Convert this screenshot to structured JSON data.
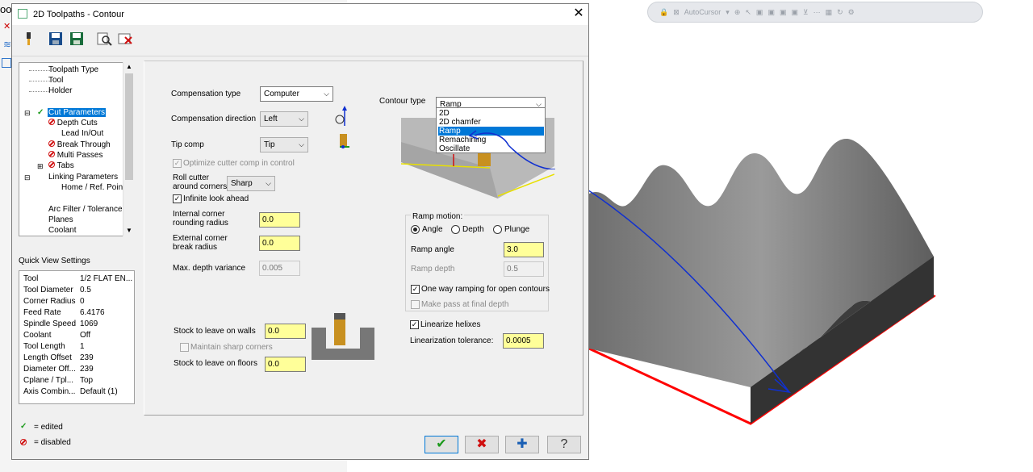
{
  "bg_app": {
    "partial_text": "ool",
    "float_toolbar": {
      "autocursor_label": "AutoCursor"
    }
  },
  "dialog": {
    "title": "2D Toolpaths - Contour",
    "close_glyph": "✕"
  },
  "tree": {
    "items": [
      {
        "label": "Toolpath Type"
      },
      {
        "label": "Tool"
      },
      {
        "label": "Holder"
      },
      {
        "label": "Cut Parameters"
      },
      {
        "label": "Depth Cuts"
      },
      {
        "label": "Lead In/Out"
      },
      {
        "label": "Break Through"
      },
      {
        "label": "Multi Passes"
      },
      {
        "label": "Tabs"
      },
      {
        "label": "Linking Parameters"
      },
      {
        "label": "Home / Ref. Points"
      },
      {
        "label": "Arc Filter / Tolerance"
      },
      {
        "label": "Planes"
      },
      {
        "label": "Coolant"
      }
    ]
  },
  "quick_view": {
    "title": "Quick View Settings",
    "rows": [
      {
        "k": "Tool",
        "v": "1/2 FLAT EN..."
      },
      {
        "k": "Tool Diameter",
        "v": "0.5"
      },
      {
        "k": "Corner Radius",
        "v": "0"
      },
      {
        "k": "Feed Rate",
        "v": "6.4176"
      },
      {
        "k": "Spindle Speed",
        "v": "1069"
      },
      {
        "k": "Coolant",
        "v": "Off"
      },
      {
        "k": "Tool Length",
        "v": "1"
      },
      {
        "k": "Length Offset",
        "v": "239"
      },
      {
        "k": "Diameter Off...",
        "v": "239"
      },
      {
        "k": "Cplane / Tpl...",
        "v": "Top"
      },
      {
        "k": "Axis Combin...",
        "v": "Default (1)"
      }
    ]
  },
  "legend": {
    "edited": "= edited",
    "disabled": "= disabled"
  },
  "params": {
    "comp_type_label": "Compensation type",
    "comp_type_value": "Computer",
    "comp_dir_label": "Compensation direction",
    "comp_dir_value": "Left",
    "tip_comp_label": "Tip comp",
    "tip_comp_value": "Tip",
    "optimize_label": "Optimize cutter comp in control",
    "roll_cutter_label_1": "Roll cutter",
    "roll_cutter_label_2": "around corners",
    "roll_cutter_value": "Sharp",
    "infinite_label": "Infinite look ahead",
    "internal_label_1": "Internal corner",
    "internal_label_2": "rounding radius",
    "internal_value": "0.0",
    "external_label_1": "External corner",
    "external_label_2": "break radius",
    "external_value": "0.0",
    "max_depth_label": "Max. depth variance",
    "max_depth_value": "0.005",
    "stock_walls_label": "Stock to leave on walls",
    "stock_walls_value": "0.0",
    "maintain_label": "Maintain sharp corners",
    "stock_floors_label": "Stock to leave on floors",
    "stock_floors_value": "0.0",
    "contour_type_label": "Contour type",
    "contour_type_value": "Ramp",
    "contour_options": [
      "2D",
      "2D chamfer",
      "Ramp",
      "Remachining",
      "Oscillate"
    ],
    "ramp_motion_title": "Ramp motion:",
    "ramp_options": [
      "Angle",
      "Depth",
      "Plunge"
    ],
    "ramp_angle_label": "Ramp angle",
    "ramp_angle_value": "3.0",
    "ramp_depth_label": "Ramp depth",
    "ramp_depth_value": "0.5",
    "one_way_label": "One way ramping for open contours",
    "make_pass_label": "Make pass at final depth",
    "linearize_label": "Linearize helixes",
    "lin_tol_label": "Linearization tolerance:",
    "lin_tol_value": "0.0005"
  },
  "buttons": {
    "ok": "✔",
    "cancel": "✖",
    "add": "✚",
    "help": "?"
  },
  "colors": {
    "selection": "#0078d7",
    "edited_check": "#1c9a1c",
    "disabled_mark": "#d01010",
    "required_field": "#ffff99",
    "annotation_arrow": "#1030d0",
    "part_outline": "#ff0000"
  }
}
